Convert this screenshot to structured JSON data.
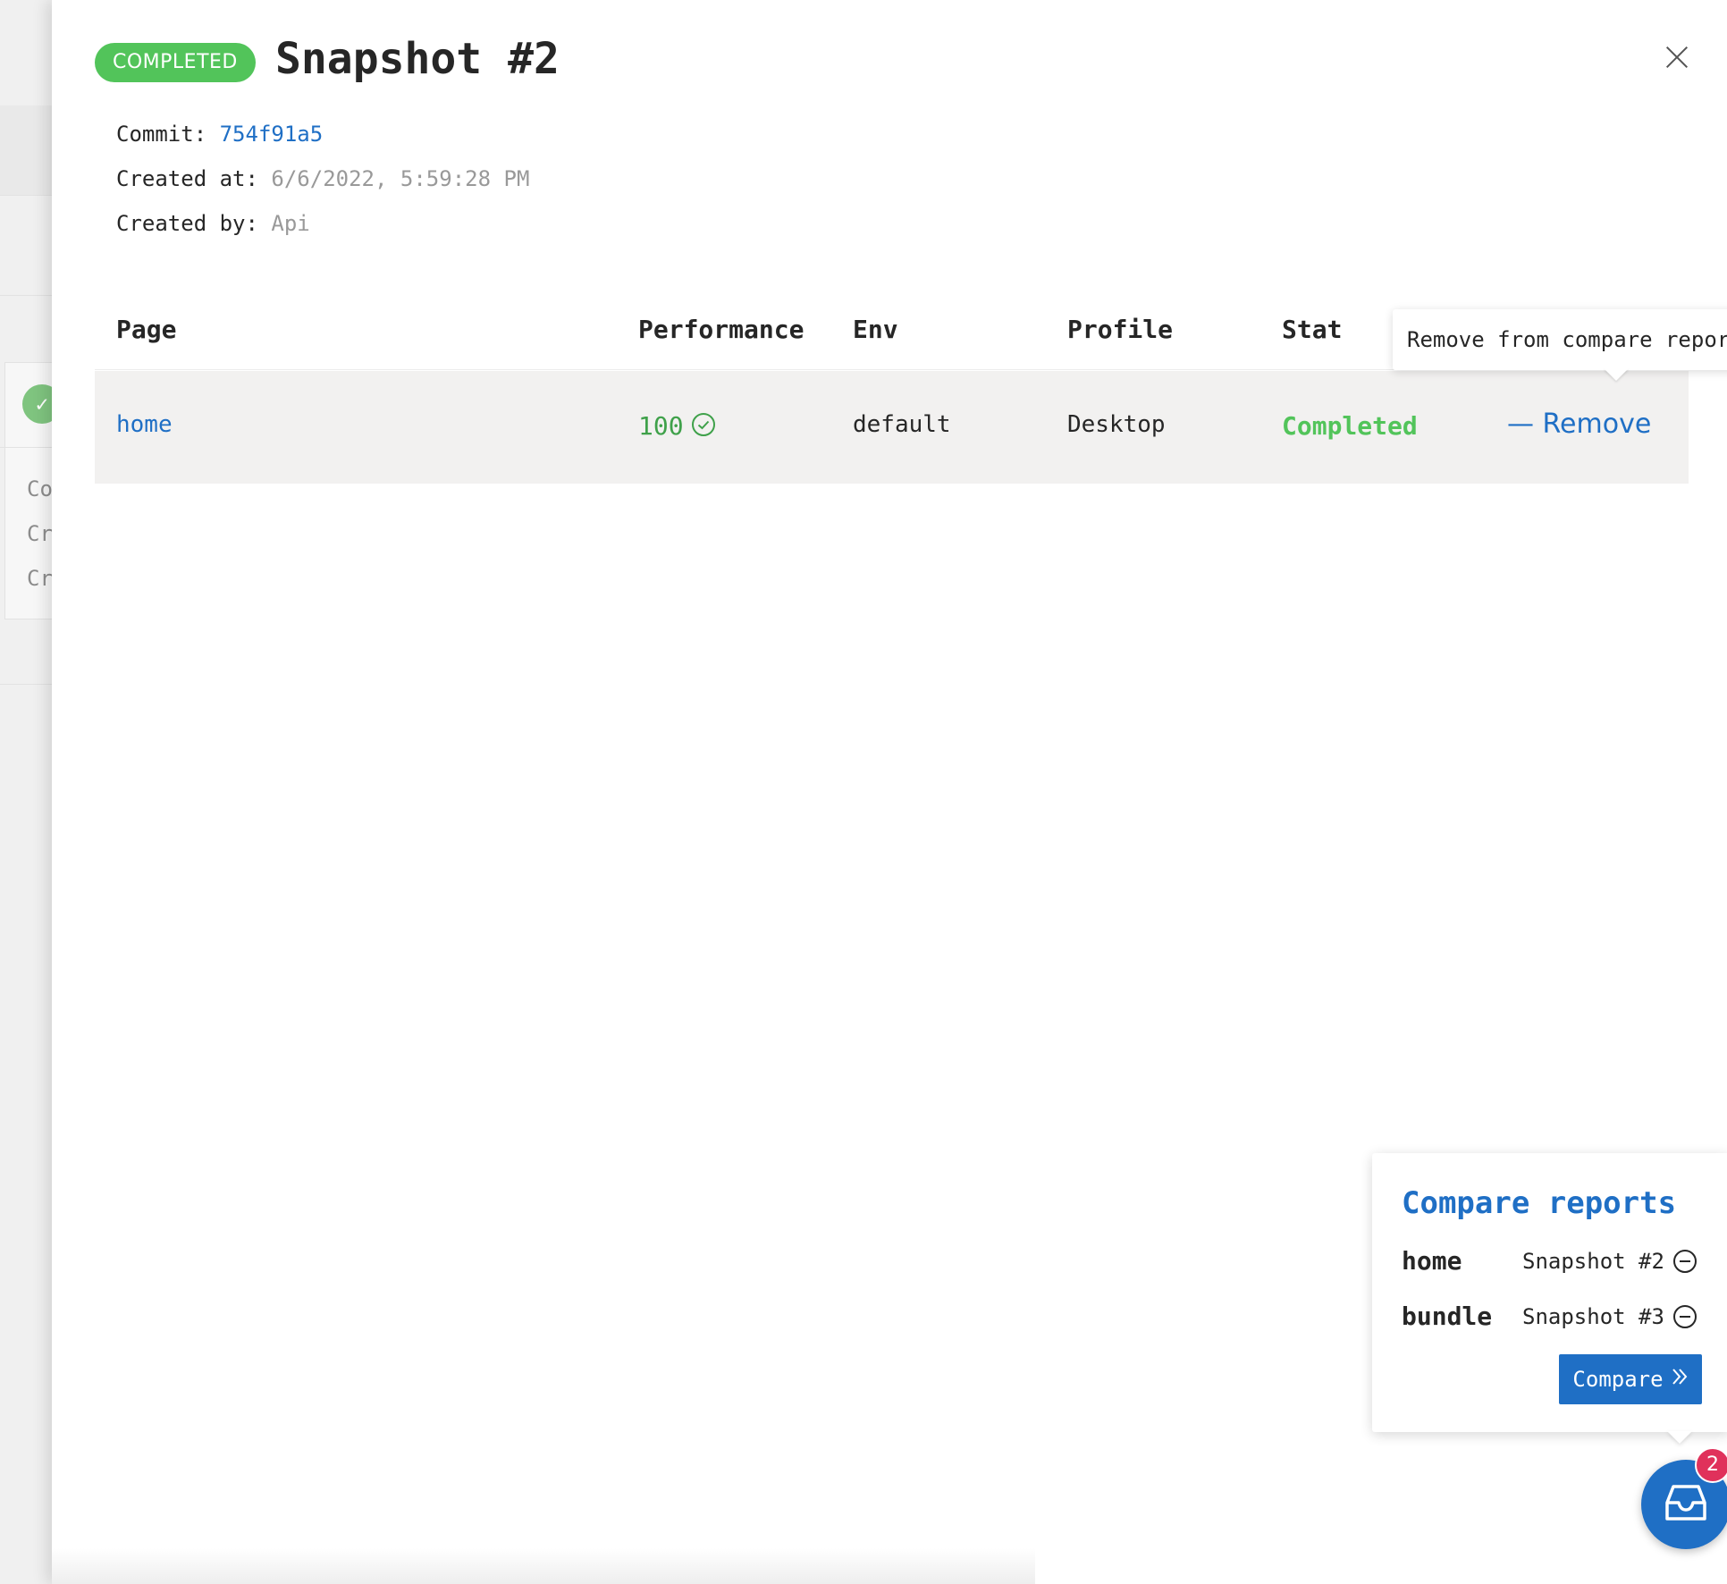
{
  "background": {
    "partial_lines": [
      "Co",
      "Cr",
      "Cr"
    ]
  },
  "drawer": {
    "status": "COMPLETED",
    "title": "Snapshot #2",
    "commit_label": "Commit:",
    "commit_value": "754f91a5",
    "created_at_label": "Created at:",
    "created_at_value": "6/6/2022, 5:59:28 PM",
    "created_by_label": "Created by:",
    "created_by_value": "Api"
  },
  "table": {
    "headers": {
      "page": "Page",
      "performance": "Performance",
      "env": "Env",
      "profile": "Profile",
      "status": "Stat"
    },
    "rows": [
      {
        "page": "home",
        "performance": "100",
        "env": "default",
        "profile": "Desktop",
        "status": "Completed",
        "action": "— Remove"
      }
    ]
  },
  "tooltip": {
    "text": "Remove from compare reports"
  },
  "compare": {
    "title": "Compare reports",
    "items": [
      {
        "name": "home",
        "snapshot": "Snapshot #2"
      },
      {
        "name": "bundle",
        "snapshot": "Snapshot #3"
      }
    ],
    "button_label": "Compare",
    "badge_count": "2"
  },
  "colors": {
    "accent": "#1f6fc5",
    "success": "#52c45a",
    "badge": "#e0315b"
  },
  "icons": {
    "close": "close-icon",
    "performance": "check-circle-icon",
    "remove_item": "minus-circle-icon",
    "compare_button": "double-chevron-right-icon",
    "fab": "inbox-icon"
  }
}
